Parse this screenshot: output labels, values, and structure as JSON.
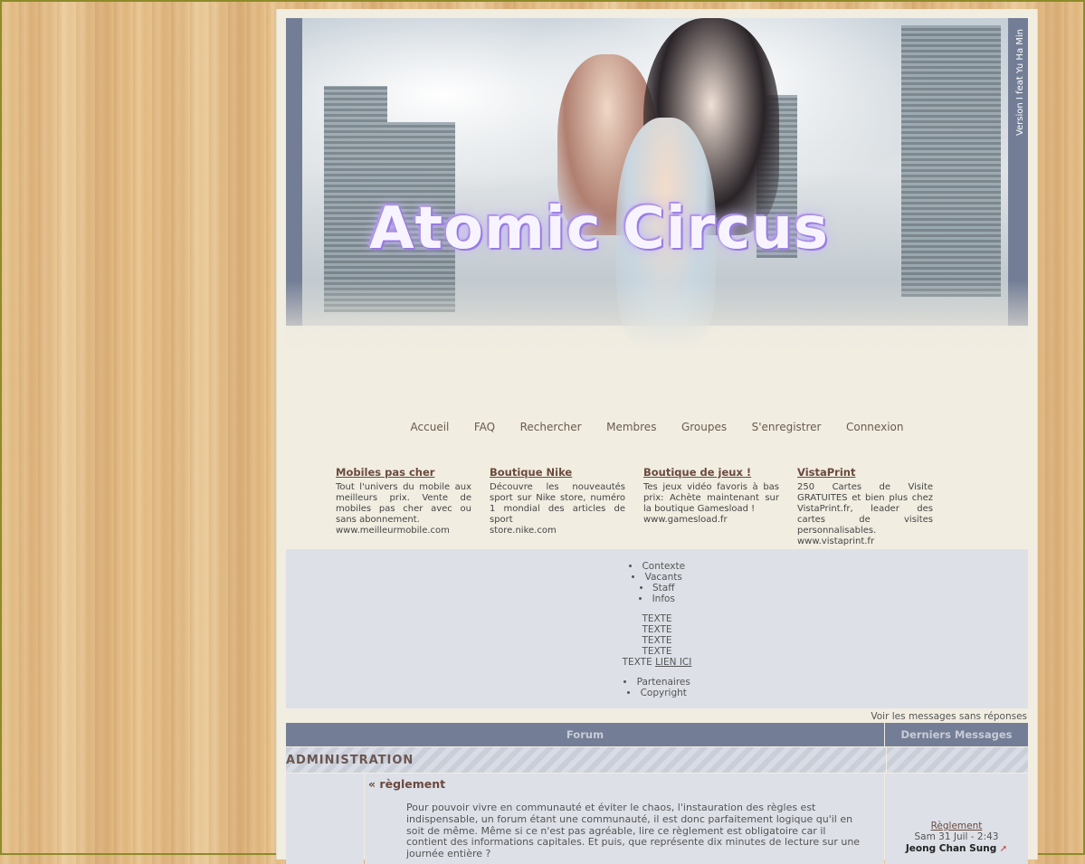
{
  "banner": {
    "title": "Atomic Circus",
    "version": "Version I feat Yu Ha Min"
  },
  "nav": {
    "items": [
      "Accueil",
      "FAQ",
      "Rechercher",
      "Membres",
      "Groupes",
      "S'enregistrer",
      "Connexion"
    ]
  },
  "ads": [
    {
      "title": "Mobiles pas cher",
      "desc": "Tout l'univers du mobile aux meilleurs prix. Vente de mobiles pas cher avec ou sans abonnement.",
      "url": "www.meilleurmobile.com"
    },
    {
      "title": "Boutique Nike",
      "desc": "Découvre les nouveautés sport sur Nike store, numéro 1 mondial des articles de sport",
      "url": "store.nike.com"
    },
    {
      "title": "Boutique de jeux !",
      "desc": "Tes jeux vidéo favoris à bas prix: Achète maintenant sur la boutique Gamesload !",
      "url": "www.gamesload.fr"
    },
    {
      "title": "VistaPrint",
      "desc": "250 Cartes de Visite GRATUITES et bien plus chez VistaPrint.fr, leader des cartes de visites personnalisables.",
      "url": "www.vistaprint.fr"
    }
  ],
  "context": {
    "list1": [
      "Contexte",
      "Vacants",
      "Staff",
      "Infos"
    ],
    "texts": [
      "TEXTE",
      "TEXTE",
      "TEXTE",
      "TEXTE"
    ],
    "last_prefix": "TEXTE",
    "link": "LIEN ICI",
    "list2": [
      "Partenaires",
      "Copyright"
    ]
  },
  "unanswered": "Voir les messages sans réponses",
  "table": {
    "col_forum": "Forum",
    "col_last": "Derniers Messages",
    "category": "ADMINISTRATION",
    "forum": {
      "name": "« règlement",
      "desc": "Pour pouvoir vivre en communauté et éviter le chaos, l'instauration des règles est indispensable, un forum étant une communauté, il est donc parfaitement logique qu'il en soit de même. Même si ce n'est pas agréable, lire ce règlement est obligatoire car il contient des informations capitales. Et puis, que représente dix minutes de lecture sur une journée entière ?",
      "last_title": "Règlement",
      "last_date": "Sam 31 Juil - 2:43",
      "last_user": "Jeong Chan Sung"
    }
  }
}
